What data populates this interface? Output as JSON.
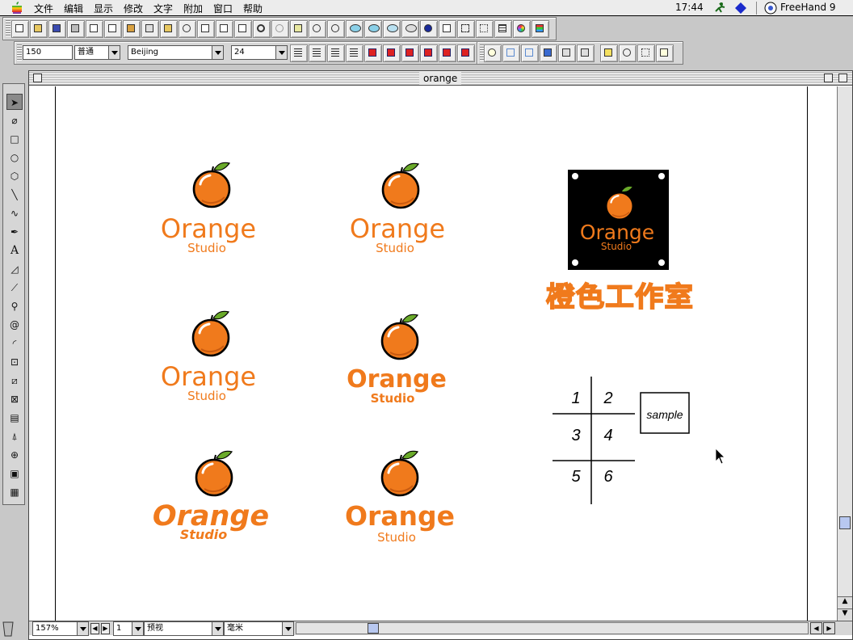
{
  "menubar": {
    "items": [
      "文件",
      "编辑",
      "显示",
      "修改",
      "文字",
      "附加",
      "窗口",
      "帮助"
    ],
    "clock": "17:44",
    "app_name": "FreeHand 9"
  },
  "text_toolbar": {
    "size_field": "150",
    "style_select": "普通",
    "font_select": "Beijing",
    "point_size": "24"
  },
  "document": {
    "title": "orange"
  },
  "artwork": {
    "logo_word": "Orange",
    "logo_sub": "Studio",
    "chinese_title": "橙色工作室",
    "grid_cells": [
      "1",
      "2",
      "3",
      "4",
      "5",
      "6"
    ],
    "sample_label": "sample"
  },
  "statusbar": {
    "zoom": "157%",
    "page": "1",
    "view_mode": "预视",
    "units": "毫米"
  },
  "colors": {
    "orange": "#f07a1c",
    "leaf": "#6aaa2a",
    "black_tile": "#000000"
  }
}
